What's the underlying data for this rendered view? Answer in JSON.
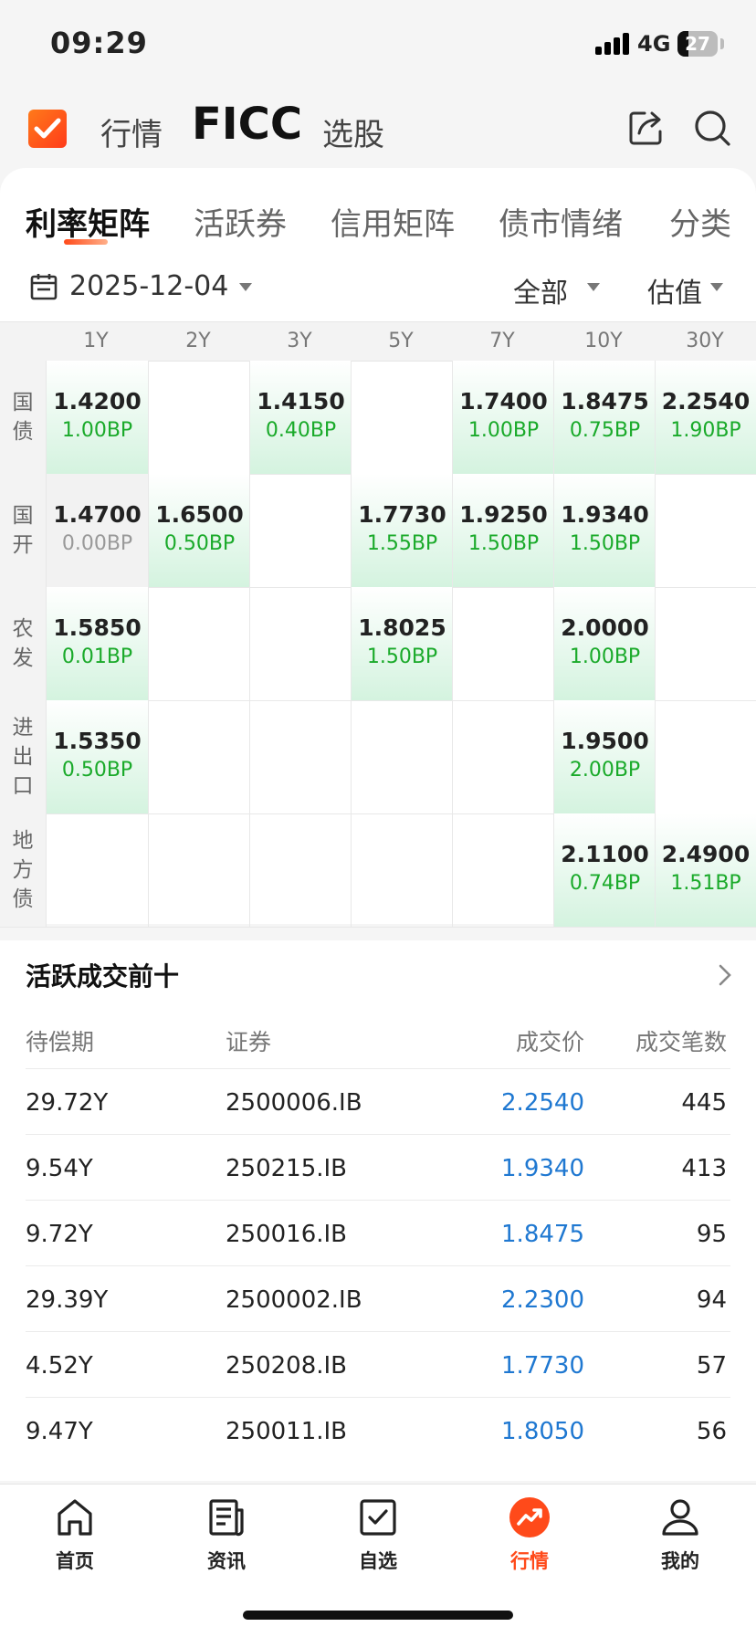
{
  "status": {
    "time": "09:29",
    "network": "4G",
    "battery": "27"
  },
  "topbar": {
    "left_tab": "行情",
    "active_tab": "FICC",
    "right_tab": "选股",
    "share_icon": "share-icon",
    "search_icon": "search-icon"
  },
  "tabs": [
    "利率矩阵",
    "活跃券",
    "信用矩阵",
    "债市情绪",
    "分类"
  ],
  "filters": {
    "date": "2025-12-04",
    "scope": "全部",
    "metric": "估值"
  },
  "matrix": {
    "columns": [
      "1Y",
      "2Y",
      "3Y",
      "5Y",
      "7Y",
      "10Y",
      "30Y"
    ],
    "rows": [
      {
        "label": [
          "国",
          "债"
        ],
        "cells": [
          {
            "v": "1.4200",
            "bp": "1.00BP"
          },
          {},
          {
            "v": "1.4150",
            "bp": "0.40BP"
          },
          {},
          {
            "v": "1.7400",
            "bp": "1.00BP"
          },
          {
            "v": "1.8475",
            "bp": "0.75BP"
          },
          {
            "v": "2.2540",
            "bp": "1.90BP"
          }
        ]
      },
      {
        "label": [
          "国",
          "开"
        ],
        "cells": [
          {
            "v": "1.4700",
            "bp": "0.00BP",
            "neutral": true
          },
          {
            "v": "1.6500",
            "bp": "0.50BP"
          },
          {},
          {
            "v": "1.7730",
            "bp": "1.55BP"
          },
          {
            "v": "1.9250",
            "bp": "1.50BP"
          },
          {
            "v": "1.9340",
            "bp": "1.50BP"
          },
          {}
        ]
      },
      {
        "label": [
          "农",
          "发"
        ],
        "cells": [
          {
            "v": "1.5850",
            "bp": "0.01BP"
          },
          {},
          {},
          {
            "v": "1.8025",
            "bp": "1.50BP"
          },
          {},
          {
            "v": "2.0000",
            "bp": "1.00BP"
          },
          {}
        ]
      },
      {
        "label": [
          "进",
          "出",
          "口"
        ],
        "cells": [
          {
            "v": "1.5350",
            "bp": "0.50BP"
          },
          {},
          {},
          {},
          {},
          {
            "v": "1.9500",
            "bp": "2.00BP"
          },
          {}
        ]
      },
      {
        "label": [
          "地",
          "方",
          "债"
        ],
        "cells": [
          {},
          {},
          {},
          {},
          {},
          {
            "v": "2.1100",
            "bp": "0.74BP"
          },
          {
            "v": "2.4900",
            "bp": "1.51BP"
          }
        ]
      }
    ]
  },
  "active": {
    "title": "活跃成交前十",
    "headers": [
      "待偿期",
      "证券",
      "成交价",
      "成交笔数"
    ],
    "rows": [
      [
        "29.72Y",
        "2500006.IB",
        "2.2540",
        "445"
      ],
      [
        "9.54Y",
        "250215.IB",
        "1.9340",
        "413"
      ],
      [
        "9.72Y",
        "250016.IB",
        "1.8475",
        "95"
      ],
      [
        "29.39Y",
        "2500002.IB",
        "2.2300",
        "94"
      ],
      [
        "4.52Y",
        "250208.IB",
        "1.7730",
        "57"
      ],
      [
        "9.47Y",
        "250011.IB",
        "1.8050",
        "56"
      ]
    ]
  },
  "bottom_nav": [
    {
      "label": "首页",
      "icon": "home-icon"
    },
    {
      "label": "资讯",
      "icon": "news-icon"
    },
    {
      "label": "自选",
      "icon": "watchlist-icon"
    },
    {
      "label": "行情",
      "icon": "market-icon",
      "active": true
    },
    {
      "label": "我的",
      "icon": "profile-icon"
    }
  ],
  "colors": {
    "accent": "#ff4a1a",
    "up": "#1aaa2a",
    "price": "#1f78d1"
  }
}
